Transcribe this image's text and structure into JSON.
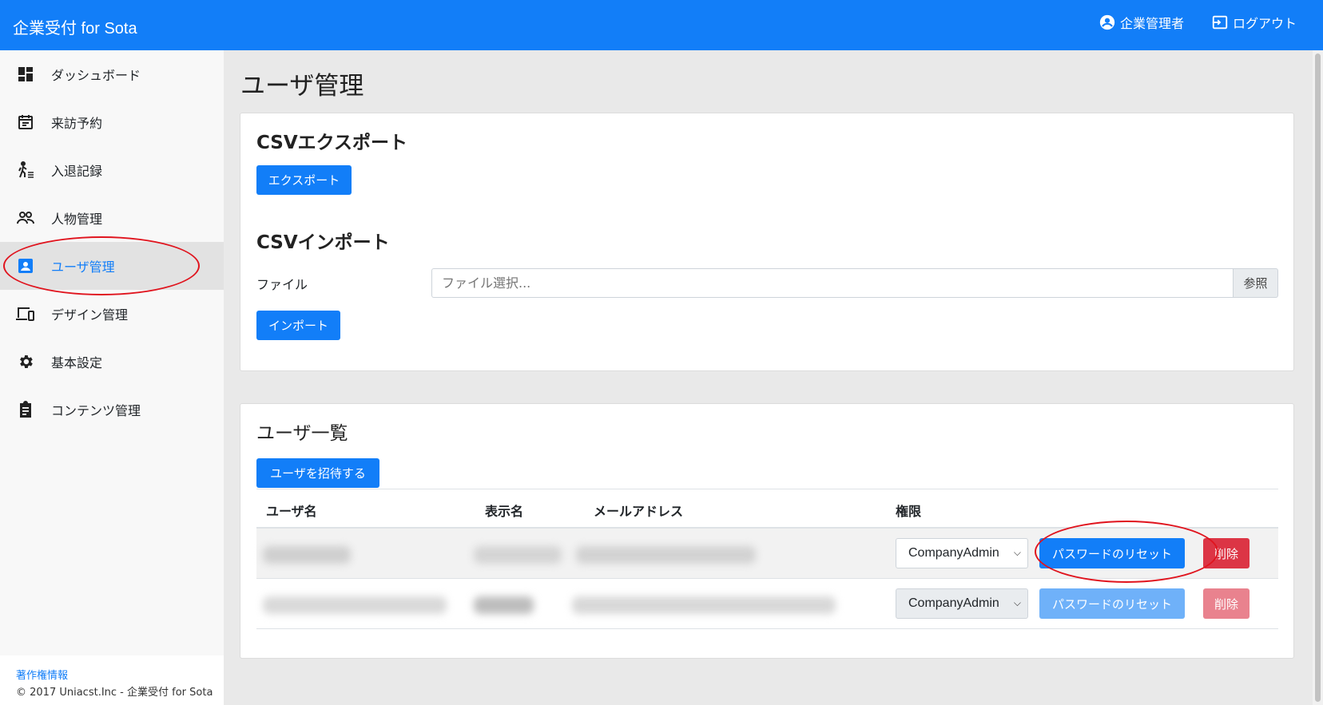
{
  "header": {
    "brand": "企業受付 for Sota",
    "user_label": "企業管理者",
    "logout_label": "ログアウト",
    "user_icon": "account-circle-icon",
    "logout_icon": "logout-icon"
  },
  "sidebar": {
    "items": [
      {
        "label": "ダッシュボード",
        "icon": "dashboard-icon"
      },
      {
        "label": "来訪予約",
        "icon": "calendar-icon"
      },
      {
        "label": "入退記録",
        "icon": "walk-icon"
      },
      {
        "label": "人物管理",
        "icon": "people-icon"
      },
      {
        "label": "ユーザ管理",
        "icon": "account-box-icon"
      },
      {
        "label": "デザイン管理",
        "icon": "devices-icon"
      },
      {
        "label": "基本設定",
        "icon": "settings-icon"
      },
      {
        "label": "コンテンツ管理",
        "icon": "clipboard-icon"
      }
    ],
    "active_index": 4,
    "footer_link": "著作権情報",
    "footer_copy": "© 2017 Uniacst.Inc - 企業受付 for Sota"
  },
  "main": {
    "title": "ユーザ管理",
    "export_section": {
      "title": "CSVエクスポート",
      "button": "エクスポート"
    },
    "import_section": {
      "title": "CSVインポート",
      "file_label": "ファイル",
      "file_placeholder": "ファイル選択...",
      "browse_label": "参照",
      "button": "インポート"
    },
    "users_section": {
      "title": "ユーザ一覧",
      "invite_button": "ユーザを招待する",
      "columns": [
        "ユーザ名",
        "表示名",
        "メールアドレス",
        "権限"
      ],
      "rows": [
        {
          "role": "CompanyAdmin",
          "reset_label": "パスワードのリセット",
          "delete_label": "削除",
          "enabled": true
        },
        {
          "role": "CompanyAdmin",
          "reset_label": "パスワードのリセット",
          "delete_label": "削除",
          "enabled": false
        }
      ]
    }
  },
  "colors": {
    "primary": "#127ef8",
    "danger": "#dc3545",
    "highlight": "#e0141e"
  }
}
